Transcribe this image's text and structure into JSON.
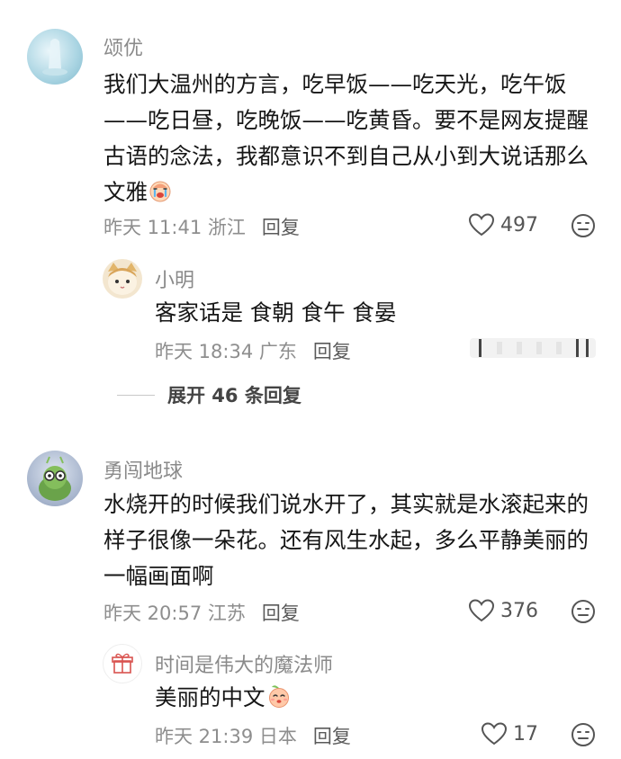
{
  "comments": [
    {
      "name": "颂优",
      "lines": [
        "我们大温州的方言，吃早饭——吃天光，吃午饭",
        "——吃日昼，吃晚饭——吃黄昏。要不是网友提醒",
        "古语的念法，我都意识不到自己从小到大说话那么",
        "文雅"
      ],
      "time": "昨天 11:41 浙江",
      "reply_label": "回复",
      "likes": "497",
      "replies": [
        {
          "name": "小明",
          "text": "客家话是 食朝 食午 食晏",
          "time": "昨天 18:34 广东",
          "reply_label": "回复"
        }
      ],
      "expand_label": "展开 46 条回复"
    },
    {
      "name": "勇闯地球",
      "lines": [
        "水烧开的时候我们说水开了，其实就是水滚起来的",
        "样子很像一朵花。还有风生水起，多么平静美丽的",
        "一幅画面啊"
      ],
      "time": "昨天 20:57 江苏",
      "reply_label": "回复",
      "likes": "376",
      "replies": [
        {
          "name": "时间是伟大的魔法师",
          "text": "美丽的中文",
          "time": "昨天 21:39 日本",
          "reply_label": "回复",
          "likes": "17"
        }
      ]
    }
  ]
}
